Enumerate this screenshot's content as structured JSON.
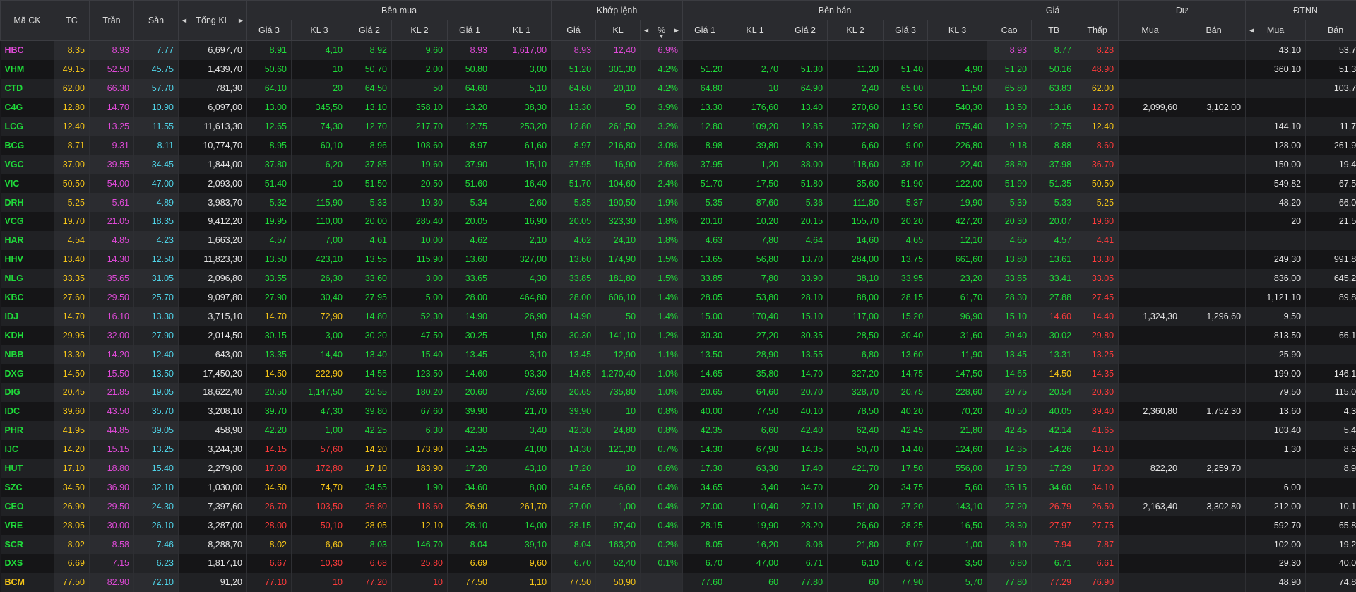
{
  "colors": {
    "up": "#1fdc3a",
    "down": "#ff3b3b",
    "ref": "#f5c518",
    "ceil": "#e04ad8",
    "floor": "#4fd4e8"
  },
  "header": {
    "symbol": "Mã CK",
    "ref": "TC",
    "ceil": "Trần",
    "floor": "Sàn",
    "total": "Tổng KL",
    "bid_group": "Bên mua",
    "match_group": "Khớp lệnh",
    "ask_group": "Bên bán",
    "price_group": "Giá",
    "rem_group": "Dư",
    "foreign_group": "ĐTNN",
    "bid": [
      "Giá 3",
      "KL 3",
      "Giá 2",
      "KL 2",
      "Giá 1",
      "KL 1"
    ],
    "match": [
      "Giá",
      "KL",
      "%"
    ],
    "ask": [
      "Giá 1",
      "KL 1",
      "Giá 2",
      "KL 2",
      "Giá 3",
      "KL 3"
    ],
    "price": [
      "Cao",
      "TB",
      "Thấp"
    ],
    "rem": [
      "Mua",
      "Bán"
    ],
    "foreign": [
      "Mua",
      "Bán"
    ]
  },
  "rows": [
    [
      "HBC",
      "8.35",
      "8.93",
      "7.77",
      "6,697,70",
      "8.91",
      "4,10",
      "8.92",
      "9,60",
      "8.93",
      "1,617,00",
      "8.93",
      "12,40",
      "6.9%",
      "",
      "",
      "",
      "",
      "",
      "",
      "8.93",
      "8.77",
      "8.28",
      "",
      "",
      "43,10",
      "53,70"
    ],
    [
      "VHM",
      "49.15",
      "52.50",
      "45.75",
      "1,439,70",
      "50.60",
      "10",
      "50.70",
      "2,00",
      "50.80",
      "3,00",
      "51.20",
      "301,30",
      "4.2%",
      "51.20",
      "2,70",
      "51.30",
      "11,20",
      "51.40",
      "4,90",
      "51.20",
      "50.16",
      "48.90",
      "",
      "",
      "360,10",
      "51,30"
    ],
    [
      "CTD",
      "62.00",
      "66.30",
      "57.70",
      "781,30",
      "64.10",
      "20",
      "64.50",
      "50",
      "64.60",
      "5,10",
      "64.60",
      "20,10",
      "4.2%",
      "64.80",
      "10",
      "64.90",
      "2,40",
      "65.00",
      "11,50",
      "65.80",
      "63.83",
      "62.00",
      "",
      "",
      "",
      "103,70"
    ],
    [
      "C4G",
      "12.80",
      "14.70",
      "10.90",
      "6,097,00",
      "13.00",
      "345,50",
      "13.10",
      "358,10",
      "13.20",
      "38,30",
      "13.30",
      "50",
      "3.9%",
      "13.30",
      "176,60",
      "13.40",
      "270,60",
      "13.50",
      "540,30",
      "13.50",
      "13.16",
      "12.70",
      "2,099,60",
      "3,102,00",
      "",
      ""
    ],
    [
      "LCG",
      "12.40",
      "13.25",
      "11.55",
      "11,613,30",
      "12.65",
      "74,30",
      "12.70",
      "217,70",
      "12.75",
      "253,20",
      "12.80",
      "261,50",
      "3.2%",
      "12.80",
      "109,20",
      "12.85",
      "372,90",
      "12.90",
      "675,40",
      "12.90",
      "12.75",
      "12.40",
      "",
      "",
      "144,10",
      "11,73"
    ],
    [
      "BCG",
      "8.71",
      "9.31",
      "8.11",
      "10,774,70",
      "8.95",
      "60,10",
      "8.96",
      "108,60",
      "8.97",
      "61,60",
      "8.97",
      "216,80",
      "3.0%",
      "8.98",
      "39,80",
      "8.99",
      "6,60",
      "9.00",
      "226,80",
      "9.18",
      "8.88",
      "8.60",
      "",
      "",
      "128,00",
      "261,90"
    ],
    [
      "VGC",
      "37.00",
      "39.55",
      "34.45",
      "1,844,00",
      "37.80",
      "6,20",
      "37.85",
      "19,60",
      "37.90",
      "15,10",
      "37.95",
      "16,90",
      "2.6%",
      "37.95",
      "1,20",
      "38.00",
      "118,60",
      "38.10",
      "22,40",
      "38.80",
      "37.98",
      "36.70",
      "",
      "",
      "150,00",
      "19,41"
    ],
    [
      "VIC",
      "50.50",
      "54.00",
      "47.00",
      "2,093,00",
      "51.40",
      "10",
      "51.50",
      "20,50",
      "51.60",
      "16,40",
      "51.70",
      "104,60",
      "2.4%",
      "51.70",
      "17,50",
      "51.80",
      "35,60",
      "51.90",
      "122,00",
      "51.90",
      "51.35",
      "50.50",
      "",
      "",
      "549,82",
      "67,55"
    ],
    [
      "DRH",
      "5.25",
      "5.61",
      "4.89",
      "3,983,70",
      "5.32",
      "115,90",
      "5.33",
      "19,30",
      "5.34",
      "2,60",
      "5.35",
      "190,50",
      "1.9%",
      "5.35",
      "87,60",
      "5.36",
      "111,80",
      "5.37",
      "19,90",
      "5.39",
      "5.33",
      "5.25",
      "",
      "",
      "48,20",
      "66,00"
    ],
    [
      "VCG",
      "19.70",
      "21.05",
      "18.35",
      "9,412,20",
      "19.95",
      "110,00",
      "20.00",
      "285,40",
      "20.05",
      "16,90",
      "20.05",
      "323,30",
      "1.8%",
      "20.10",
      "10,20",
      "20.15",
      "155,70",
      "20.20",
      "427,20",
      "20.30",
      "20.07",
      "19.60",
      "",
      "",
      "20",
      "21,50"
    ],
    [
      "HAR",
      "4.54",
      "4.85",
      "4.23",
      "1,663,20",
      "4.57",
      "7,00",
      "4.61",
      "10,00",
      "4.62",
      "2,10",
      "4.62",
      "24,10",
      "1.8%",
      "4.63",
      "7,80",
      "4.64",
      "14,60",
      "4.65",
      "12,10",
      "4.65",
      "4.57",
      "4.41",
      "",
      "",
      "",
      ""
    ],
    [
      "HHV",
      "13.40",
      "14.30",
      "12.50",
      "11,823,30",
      "13.50",
      "423,10",
      "13.55",
      "115,90",
      "13.60",
      "327,00",
      "13.60",
      "174,90",
      "1.5%",
      "13.65",
      "56,80",
      "13.70",
      "284,00",
      "13.75",
      "661,60",
      "13.80",
      "13.61",
      "13.30",
      "",
      "",
      "249,30",
      "991,82"
    ],
    [
      "NLG",
      "33.35",
      "35.65",
      "31.05",
      "2,096,80",
      "33.55",
      "26,30",
      "33.60",
      "3,00",
      "33.65",
      "4,30",
      "33.85",
      "181,80",
      "1.5%",
      "33.85",
      "7,80",
      "33.90",
      "38,10",
      "33.95",
      "23,20",
      "33.85",
      "33.41",
      "33.05",
      "",
      "",
      "836,00",
      "645,20"
    ],
    [
      "KBC",
      "27.60",
      "29.50",
      "25.70",
      "9,097,80",
      "27.90",
      "30,40",
      "27.95",
      "5,00",
      "28.00",
      "464,80",
      "28.00",
      "606,10",
      "1.4%",
      "28.05",
      "53,80",
      "28.10",
      "88,00",
      "28.15",
      "61,70",
      "28.30",
      "27.88",
      "27.45",
      "",
      "",
      "1,121,10",
      "89,80"
    ],
    [
      "IDJ",
      "14.70",
      "16.10",
      "13.30",
      "3,715,10",
      "14.70",
      "72,90",
      "14.80",
      "52,30",
      "14.90",
      "26,90",
      "14.90",
      "50",
      "1.4%",
      "15.00",
      "170,40",
      "15.10",
      "117,00",
      "15.20",
      "96,90",
      "15.10",
      "14.60",
      "14.40",
      "1,324,30",
      "1,296,60",
      "9,50",
      ""
    ],
    [
      "KDH",
      "29.95",
      "32.00",
      "27.90",
      "2,014,50",
      "30.15",
      "3,00",
      "30.20",
      "47,50",
      "30.25",
      "1,50",
      "30.30",
      "141,10",
      "1.2%",
      "30.30",
      "27,20",
      "30.35",
      "28,50",
      "30.40",
      "31,60",
      "30.40",
      "30.02",
      "29.80",
      "",
      "",
      "813,50",
      "66,10"
    ],
    [
      "NBB",
      "13.30",
      "14.20",
      "12.40",
      "643,00",
      "13.35",
      "14,40",
      "13.40",
      "15,40",
      "13.45",
      "3,10",
      "13.45",
      "12,90",
      "1.1%",
      "13.50",
      "28,90",
      "13.55",
      "6,80",
      "13.60",
      "11,90",
      "13.45",
      "13.31",
      "13.25",
      "",
      "",
      "25,90",
      ""
    ],
    [
      "DXG",
      "14.50",
      "15.50",
      "13.50",
      "17,450,20",
      "14.50",
      "222,90",
      "14.55",
      "123,50",
      "14.60",
      "93,30",
      "14.65",
      "1,270,40",
      "1.0%",
      "14.65",
      "35,80",
      "14.70",
      "327,20",
      "14.75",
      "147,50",
      "14.65",
      "14.50",
      "14.35",
      "",
      "",
      "199,00",
      "146,10"
    ],
    [
      "DIG",
      "20.45",
      "21.85",
      "19.05",
      "18,622,40",
      "20.50",
      "1,147,50",
      "20.55",
      "180,20",
      "20.60",
      "73,60",
      "20.65",
      "735,80",
      "1.0%",
      "20.65",
      "64,60",
      "20.70",
      "328,70",
      "20.75",
      "228,60",
      "20.75",
      "20.54",
      "20.30",
      "",
      "",
      "79,50",
      "115,00"
    ],
    [
      "IDC",
      "39.60",
      "43.50",
      "35.70",
      "3,208,10",
      "39.70",
      "47,30",
      "39.80",
      "67,60",
      "39.90",
      "21,70",
      "39.90",
      "10",
      "0.8%",
      "40.00",
      "77,50",
      "40.10",
      "78,50",
      "40.20",
      "70,20",
      "40.50",
      "40.05",
      "39.40",
      "2,360,80",
      "1,752,30",
      "13,60",
      "4,30"
    ],
    [
      "PHR",
      "41.95",
      "44.85",
      "39.05",
      "458,90",
      "42.20",
      "1,00",
      "42.25",
      "6,30",
      "42.30",
      "3,40",
      "42.30",
      "24,80",
      "0.8%",
      "42.35",
      "6,60",
      "42.40",
      "62,40",
      "42.45",
      "21,80",
      "42.45",
      "42.14",
      "41.65",
      "",
      "",
      "103,40",
      "5,40"
    ],
    [
      "IJC",
      "14.20",
      "15.15",
      "13.25",
      "3,244,30",
      "14.15",
      "57,60",
      "14.20",
      "173,90",
      "14.25",
      "41,00",
      "14.30",
      "121,30",
      "0.7%",
      "14.30",
      "67,90",
      "14.35",
      "50,70",
      "14.40",
      "124,60",
      "14.35",
      "14.26",
      "14.10",
      "",
      "",
      "1,30",
      "8,60"
    ],
    [
      "HUT",
      "17.10",
      "18.80",
      "15.40",
      "2,279,00",
      "17.00",
      "172,80",
      "17.10",
      "183,90",
      "17.20",
      "43,10",
      "17.20",
      "10",
      "0.6%",
      "17.30",
      "63,30",
      "17.40",
      "421,70",
      "17.50",
      "556,00",
      "17.50",
      "17.29",
      "17.00",
      "822,20",
      "2,259,70",
      "",
      "8,92"
    ],
    [
      "SZC",
      "34.50",
      "36.90",
      "32.10",
      "1,030,00",
      "34.50",
      "74,70",
      "34.55",
      "1,90",
      "34.60",
      "8,00",
      "34.65",
      "46,60",
      "0.4%",
      "34.65",
      "3,40",
      "34.70",
      "20",
      "34.75",
      "5,60",
      "35.15",
      "34.60",
      "34.10",
      "",
      "",
      "6,00",
      ""
    ],
    [
      "CEO",
      "26.90",
      "29.50",
      "24.30",
      "7,397,60",
      "26.70",
      "103,50",
      "26.80",
      "118,60",
      "26.90",
      "261,70",
      "27.00",
      "1,00",
      "0.4%",
      "27.00",
      "110,40",
      "27.10",
      "151,00",
      "27.20",
      "143,10",
      "27.20",
      "26.79",
      "26.50",
      "2,163,40",
      "3,302,80",
      "212,00",
      "10,12"
    ],
    [
      "VRE",
      "28.05",
      "30.00",
      "26.10",
      "3,287,00",
      "28.00",
      "50,10",
      "28.05",
      "12,10",
      "28.10",
      "14,00",
      "28.15",
      "97,40",
      "0.4%",
      "28.15",
      "19,90",
      "28.20",
      "26,60",
      "28.25",
      "16,50",
      "28.30",
      "27.97",
      "27.75",
      "",
      "",
      "592,70",
      "65,80"
    ],
    [
      "SCR",
      "8.02",
      "8.58",
      "7.46",
      "8,288,70",
      "8.02",
      "6,60",
      "8.03",
      "146,70",
      "8.04",
      "39,10",
      "8.04",
      "163,20",
      "0.2%",
      "8.05",
      "16,20",
      "8.06",
      "21,80",
      "8.07",
      "1,00",
      "8.10",
      "7.94",
      "7.87",
      "",
      "",
      "102,00",
      "19,24"
    ],
    [
      "DXS",
      "6.69",
      "7.15",
      "6.23",
      "1,817,10",
      "6.67",
      "10,30",
      "6.68",
      "25,80",
      "6.69",
      "9,60",
      "6.70",
      "52,40",
      "0.1%",
      "6.70",
      "47,00",
      "6.71",
      "6,10",
      "6.72",
      "3,50",
      "6.80",
      "6.71",
      "6.61",
      "",
      "",
      "29,30",
      "40,00"
    ],
    [
      "BCM",
      "77.50",
      "82.90",
      "72.10",
      "91,20",
      "77.10",
      "10",
      "77.20",
      "10",
      "77.50",
      "1,10",
      "77.50",
      "50,90",
      "",
      "77.60",
      "60",
      "77.80",
      "60",
      "77.90",
      "5,70",
      "77.80",
      "77.29",
      "76.90",
      "",
      "",
      "48,90",
      "74,80"
    ]
  ]
}
